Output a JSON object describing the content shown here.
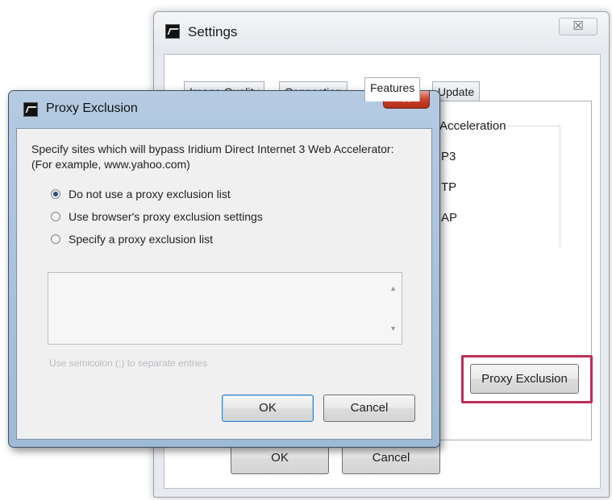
{
  "settings_window": {
    "title": "Settings",
    "close_glyph": "☒",
    "tabs": [
      "Image Quality",
      "Connection",
      "Features",
      "Update"
    ],
    "active_tab": "Features",
    "feature_fragments": [
      "Acceleration",
      "P3",
      "TP",
      "AP"
    ],
    "proxy_exclusion_button": "Proxy Exclusion",
    "ok_button": "OK",
    "cancel_button": "Cancel"
  },
  "proxy_dialog": {
    "title": "Proxy Exclusion",
    "close_glyph": "✕",
    "description": "Specify sites which will bypass Iridium Direct Internet 3 Web Accelerator: (For example, www.yahoo.com)",
    "options": [
      {
        "label": "Do not use a proxy exclusion list",
        "checked": true
      },
      {
        "label": "Use browser's proxy exclusion settings",
        "checked": false
      },
      {
        "label": "Specify a proxy exclusion list",
        "checked": false
      }
    ],
    "list_value": "",
    "hint": "Use semicolon (;) to separate entries",
    "ok_button": "OK",
    "cancel_button": "Cancel"
  },
  "colors": {
    "highlight": "#bd2e57",
    "dialog_frame": "#b4cbe2",
    "close_button": "#c9432c"
  },
  "icons": [
    "app-icon",
    "close-icon",
    "scroll-up-icon",
    "scroll-down-icon",
    "radio-icon"
  ]
}
